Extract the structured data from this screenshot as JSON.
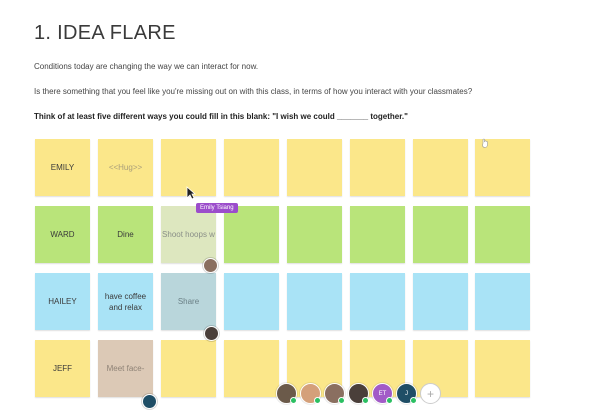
{
  "title": "1. IDEA FLARE",
  "intro": "Conditions today are changing the way we can interact for now.",
  "question": "Is there something that you feel like you're missing out on with this class, in terms of how you interact with your classmates?",
  "prompt": "Think of at least five different ways you could fill in this blank: \"I wish we could _______ together.\"",
  "rows": [
    {
      "color": "yellow",
      "cells": [
        "EMILY",
        "<<Hug>>",
        "",
        "",
        "",
        "",
        "",
        ""
      ]
    },
    {
      "color": "green",
      "cells": [
        "WARD",
        "Dine",
        "Shoot hoops w",
        "",
        "",
        "",
        "",
        ""
      ]
    },
    {
      "color": "blue",
      "cells": [
        "HAILEY",
        "have coffee and relax",
        "Share",
        "",
        "",
        "",
        "",
        ""
      ]
    },
    {
      "color": "yellow",
      "cells": [
        "JEFF",
        "Meet face-",
        "",
        "",
        "",
        "",
        "",
        ""
      ]
    }
  ],
  "tooltip": "Emily Tsiang",
  "collaborators": [
    {
      "type": "photo",
      "color": "#6b5a4a",
      "status": "#2bbf62"
    },
    {
      "type": "photo",
      "color": "#d4a07a",
      "status": "#2bbf62"
    },
    {
      "type": "photo",
      "color": "#8a6f60",
      "status": "#2bbf62"
    },
    {
      "type": "photo",
      "color": "#4a3f3a",
      "status": "#2bbf62"
    },
    {
      "type": "initials",
      "label": "ET",
      "color": "#a25bc7",
      "status": "#2bbf62"
    },
    {
      "type": "initials",
      "label": "J",
      "color": "#1f4e66",
      "status": "#2bbf62"
    },
    {
      "type": "add",
      "label": "+"
    }
  ]
}
